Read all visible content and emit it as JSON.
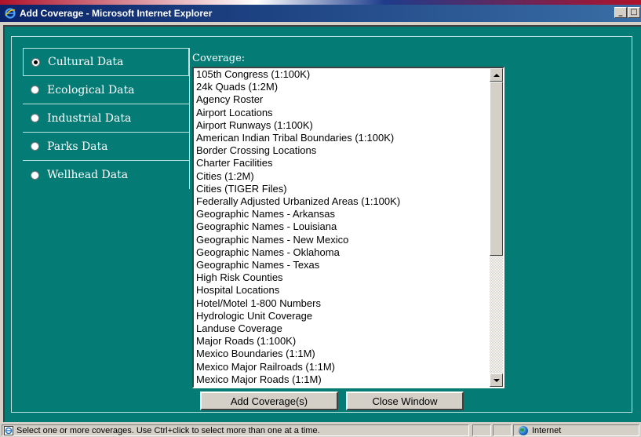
{
  "window": {
    "title": "Add Coverage - Microsoft Internet Explorer",
    "icon": "ie-icon",
    "controls": [
      "minimize",
      "maximize"
    ]
  },
  "nav": {
    "items": [
      {
        "label": "Cultural Data",
        "checked": true
      },
      {
        "label": "Ecological Data",
        "checked": false
      },
      {
        "label": "Industrial Data",
        "checked": false
      },
      {
        "label": "Parks Data",
        "checked": false
      },
      {
        "label": "Wellhead Data",
        "checked": false
      }
    ]
  },
  "coverage": {
    "label": "Coverage:",
    "items": [
      "105th Congress (1:100K)",
      "24k Quads (1:2M)",
      "Agency Roster",
      "Airport Locations",
      "Airport Runways (1:100K)",
      "American Indian Tribal Boundaries (1:100K)",
      "Border Crossing Locations",
      "Charter Facilities",
      "Cities (1:2M)",
      "Cities (TIGER Files)",
      "Federally Adjusted Urbanized Areas (1:100K)",
      "Geographic Names - Arkansas",
      "Geographic Names - Louisiana",
      "Geographic Names - New Mexico",
      "Geographic Names - Oklahoma",
      "Geographic Names - Texas",
      "High Risk Counties",
      "Hospital Locations",
      "Hotel/Motel 1-800 Numbers",
      "Hydrologic Unit Coverage",
      "Landuse Coverage",
      "Major Roads (1:100K)",
      "Mexico Boundaries (1:1M)",
      "Mexico Major Railroads (1:1M)",
      "Mexico Major Roads (1:1M)"
    ]
  },
  "buttons": {
    "add": "Add Coverage(s)",
    "close": "Close Window"
  },
  "statusbar": {
    "message": "Select one or more coverages.  Use Ctrl+click to select more than one at a time.",
    "zone": "Internet"
  },
  "colors": {
    "client_bg": "#057b76",
    "title_bg_start": "#0a246a",
    "title_bg_end": "#3a6ea5",
    "chrome": "#d4d0c8"
  }
}
